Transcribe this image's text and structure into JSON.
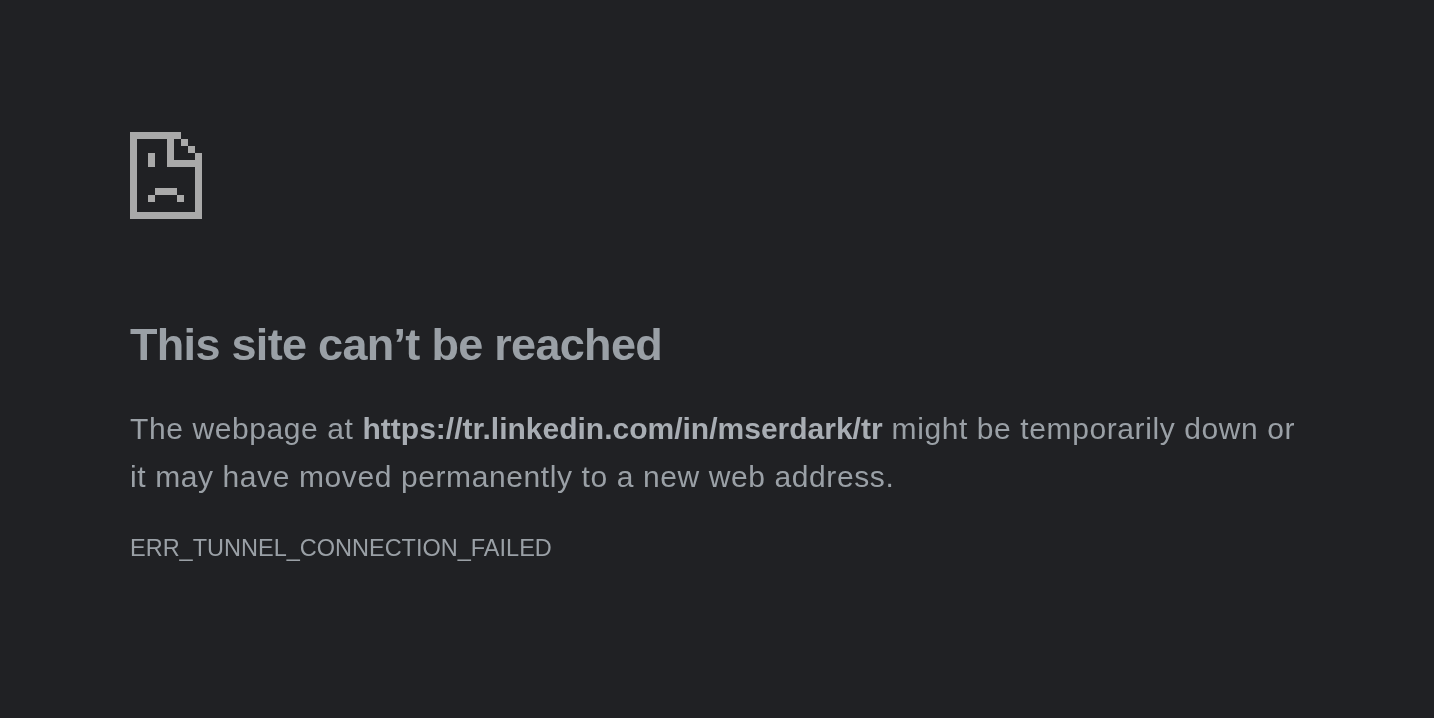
{
  "heading": "This site can’t be reached",
  "description": "The webpage at **https://tr.linkedin.com/in/mserdark/tr** might be temporarily down or it may have moved permanently to a new web address.",
  "error_code": "ERR_TUNNEL_CONNECTION_FAILED"
}
